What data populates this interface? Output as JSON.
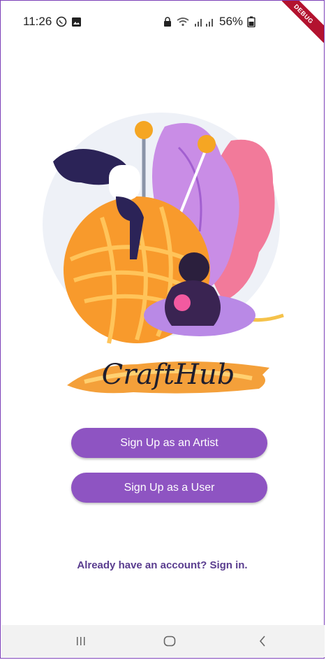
{
  "status": {
    "time": "11:26",
    "battery": "56%"
  },
  "debug_banner": "DEBUG",
  "logo": {
    "text": "CraftHub"
  },
  "buttons": {
    "artist_label": "Sign Up as an Artist",
    "user_label": "Sign Up as a User"
  },
  "signin": {
    "text": "Already have an account? Sign in."
  },
  "colors": {
    "primary": "#8e54c2",
    "link": "#5a3d8f",
    "frame_border": "#7b3fb8"
  },
  "icons": [
    "whatsapp-icon",
    "gallery-icon",
    "lock-icon",
    "wifi-icon",
    "signal-icon",
    "battery-icon",
    "recent-apps-icon",
    "home-icon",
    "back-icon"
  ]
}
